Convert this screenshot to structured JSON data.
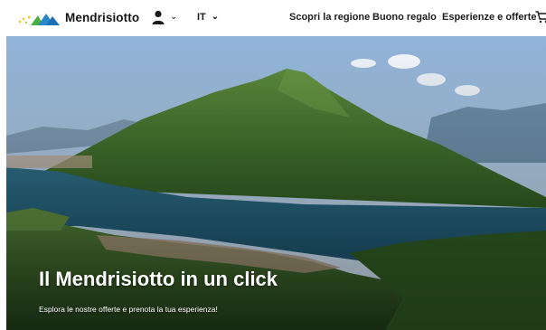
{
  "header": {
    "brand": "Mendrisiotto",
    "logo_icon": "mendrisiotto-mountains-logo",
    "user_icon": "user-icon",
    "language": "IT",
    "nav": [
      "Scopri la regione",
      "Buono regalo",
      "Esperienze e offerte"
    ],
    "cart_icon": "cart-icon"
  },
  "hero": {
    "title": "Il Mendrisiotto in un click",
    "subtitle": "Esplora le nostre offerte e prenota la tua esperienza!"
  },
  "colors": {
    "logo_blue": "#1f6fb5",
    "logo_green": "#4cae3e",
    "logo_yellow": "#f3c300",
    "lake": "#1f5b74",
    "mountain": "#3f6f2b",
    "sky": "#b9d2ea"
  }
}
